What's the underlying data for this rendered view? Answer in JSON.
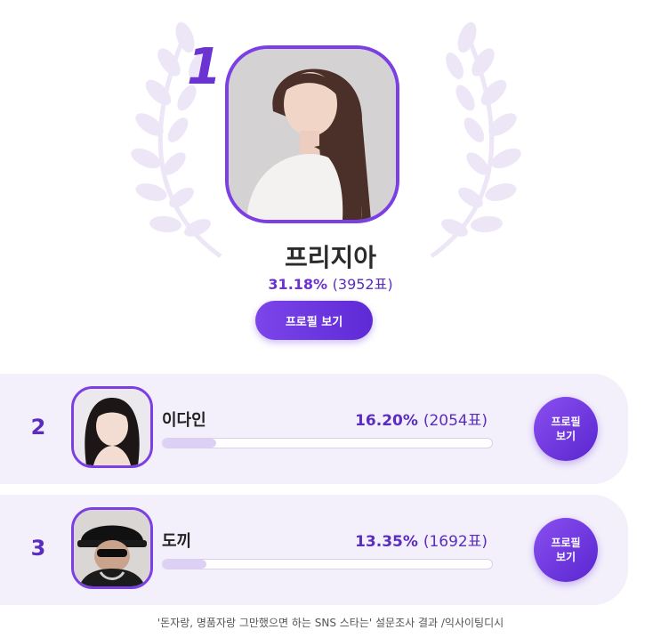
{
  "colors": {
    "accent": "#6b33d1",
    "card_bg": "#f3effb",
    "bar_fill": "#ddd0f5"
  },
  "winner": {
    "rank": "1",
    "name": "프리지아",
    "percent": "31.18%",
    "votes": "(3952표)",
    "profile_button": "프로필 보기",
    "decoration": "laurel-wreath-icon"
  },
  "rankings": [
    {
      "rank": "2",
      "name": "이다인",
      "percent": "16.20%",
      "votes": "(2054표)",
      "bar_fraction": 0.162,
      "profile_button": "프로필\n보기"
    },
    {
      "rank": "3",
      "name": "도끼",
      "percent": "13.35%",
      "votes": "(1692표)",
      "bar_fraction": 0.1335,
      "profile_button": "프로필\n보기"
    }
  ],
  "caption": "'돈자랑, 명품자랑 그만했으면 하는 SNS 스타는' 설문조사 결과 /익사이팅디시"
}
